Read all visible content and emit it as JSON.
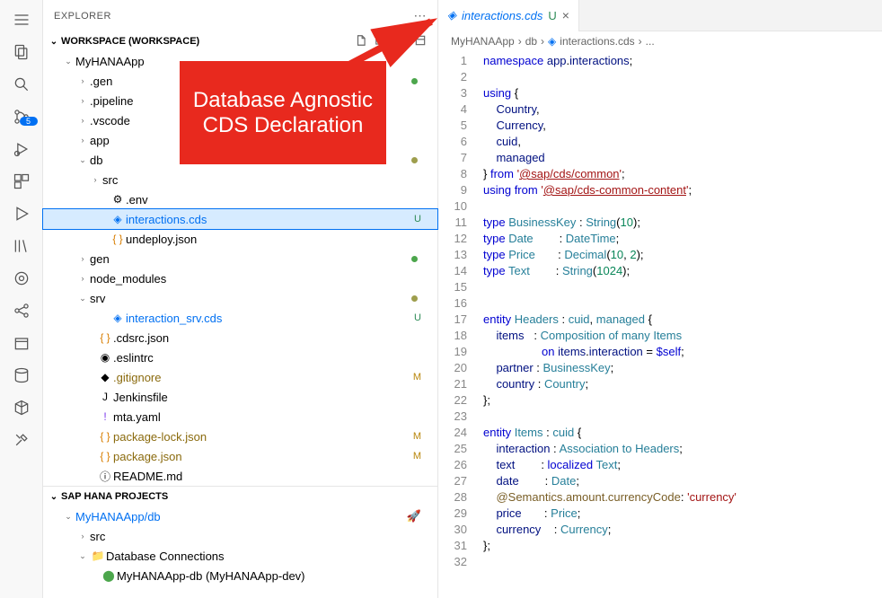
{
  "explorer": {
    "title": "EXPLORER",
    "workspace_label": "WORKSPACE (WORKSPACE)",
    "root": "MyHANAApp",
    "items": [
      {
        "name": ".gen",
        "indent": 36,
        "chev": ">",
        "dot": "green"
      },
      {
        "name": ".pipeline",
        "indent": 36,
        "chev": ">"
      },
      {
        "name": ".vscode",
        "indent": 36,
        "chev": ">"
      },
      {
        "name": "app",
        "indent": 36,
        "chev": ">"
      },
      {
        "name": "db",
        "indent": 36,
        "chev": "v",
        "dot": "olive"
      },
      {
        "name": "src",
        "indent": 50,
        "chev": ">"
      },
      {
        "name": ".env",
        "indent": 58,
        "icon": "gear"
      },
      {
        "name": "interactions.cds",
        "indent": 58,
        "icon": "cds",
        "status": "U",
        "selected": true,
        "blue": true
      },
      {
        "name": "undeploy.json",
        "indent": 58,
        "icon": "json",
        "orange": true
      },
      {
        "name": "gen",
        "indent": 36,
        "chev": ">",
        "dot": "green"
      },
      {
        "name": "node_modules",
        "indent": 36,
        "chev": ">"
      },
      {
        "name": "srv",
        "indent": 36,
        "chev": "v",
        "dot": "olive"
      },
      {
        "name": "interaction_srv.cds",
        "indent": 58,
        "icon": "cds",
        "status": "U",
        "blue": true
      },
      {
        "name": ".cdsrc.json",
        "indent": 44,
        "icon": "json"
      },
      {
        "name": ".eslintrc",
        "indent": 44,
        "icon": "eslint"
      },
      {
        "name": ".gitignore",
        "indent": 44,
        "icon": "git",
        "status": "M"
      },
      {
        "name": "Jenkinsfile",
        "indent": 44,
        "icon": "jenkins"
      },
      {
        "name": "mta.yaml",
        "indent": 44,
        "icon": "yaml"
      },
      {
        "name": "package-lock.json",
        "indent": 44,
        "icon": "json",
        "status": "M"
      },
      {
        "name": "package.json",
        "indent": 44,
        "icon": "json",
        "status": "M"
      },
      {
        "name": "README.md",
        "indent": 44,
        "icon": "md"
      }
    ],
    "hana_title": "SAP HANA PROJECTS",
    "hana": {
      "project": "MyHANAApp/db",
      "src": "src",
      "connections": "Database Connections",
      "db_conn": "MyHANAApp-db (MyHANAApp-dev)"
    }
  },
  "tab": {
    "name": "interactions.cds",
    "status": "U"
  },
  "breadcrumb": [
    "MyHANAApp",
    "db",
    "interactions.cds",
    "..."
  ],
  "callout": "Database Agnostic CDS Declaration",
  "code": [
    {
      "n": 1,
      "h": "<span class='kw'>namespace</span> <span class='id'>app</span>.<span class='id'>interactions</span>;"
    },
    {
      "n": 2,
      "h": ""
    },
    {
      "n": 3,
      "h": "<span class='kw'>using</span> {"
    },
    {
      "n": 4,
      "h": "    <span class='id'>Country</span>,"
    },
    {
      "n": 5,
      "h": "    <span class='id'>Currency</span>,"
    },
    {
      "n": 6,
      "h": "    <span class='id'>cuid</span>,"
    },
    {
      "n": 7,
      "h": "    <span class='id'>managed</span>"
    },
    {
      "n": 8,
      "h": "} <span class='kw'>from</span> <span class='str'>'<span class='u'>@sap/cds/common</span>'</span>;"
    },
    {
      "n": 9,
      "h": "<span class='kw'>using from</span> <span class='str'>'<span class='u'>@sap/cds-common-content</span>'</span>;"
    },
    {
      "n": 10,
      "h": ""
    },
    {
      "n": 11,
      "h": "<span class='kw'>type</span> <span class='ty'>BusinessKey</span> : <span class='ty'>String</span>(<span class='num'>10</span>);"
    },
    {
      "n": 12,
      "h": "<span class='kw'>type</span> <span class='ty'>Date</span>        : <span class='ty'>DateTime</span>;"
    },
    {
      "n": 13,
      "h": "<span class='kw'>type</span> <span class='ty'>Price</span>       : <span class='ty'>Decimal</span>(<span class='num'>10</span>, <span class='num'>2</span>);"
    },
    {
      "n": 14,
      "h": "<span class='kw'>type</span> <span class='ty'>Text</span>        : <span class='ty'>String</span>(<span class='num'>1024</span>);"
    },
    {
      "n": 15,
      "h": ""
    },
    {
      "n": 16,
      "h": ""
    },
    {
      "n": 17,
      "h": "<span class='kw'>entity</span> <span class='ty'>Headers</span> : <span class='ty'>cuid</span>, <span class='ty'>managed</span> {"
    },
    {
      "n": 18,
      "h": "    <span class='id'>items</span>   : <span class='ty'>Composition of many</span> <span class='ty'>Items</span>"
    },
    {
      "n": 19,
      "h": "                  <span class='kw'>on</span> <span class='id'>items</span>.<span class='id'>interaction</span> = <span class='kw'>$self</span>;"
    },
    {
      "n": 20,
      "h": "    <span class='id'>partner</span> : <span class='ty'>BusinessKey</span>;"
    },
    {
      "n": 21,
      "h": "    <span class='id'>country</span> : <span class='ty'>Country</span>;"
    },
    {
      "n": 22,
      "h": "};"
    },
    {
      "n": 23,
      "h": ""
    },
    {
      "n": 24,
      "h": "<span class='kw'>entity</span> <span class='ty'>Items</span> : <span class='ty'>cuid</span> {"
    },
    {
      "n": 25,
      "h": "    <span class='id'>interaction</span> : <span class='ty'>Association to</span> <span class='ty'>Headers</span>;"
    },
    {
      "n": 26,
      "h": "    <span class='id'>text</span>        : <span class='kw'>localized</span> <span class='ty'>Text</span>;"
    },
    {
      "n": 27,
      "h": "    <span class='id'>date</span>        : <span class='ty'>Date</span>;"
    },
    {
      "n": 28,
      "h": "    <span class='fn'>@Semantics.amount.currencyCode</span>: <span class='str'>'currency'</span>"
    },
    {
      "n": 29,
      "h": "    <span class='id'>price</span>       : <span class='ty'>Price</span>;"
    },
    {
      "n": 30,
      "h": "    <span class='id'>currency</span>    : <span class='ty'>Currency</span>;"
    },
    {
      "n": 31,
      "h": "};"
    },
    {
      "n": 32,
      "h": ""
    }
  ]
}
